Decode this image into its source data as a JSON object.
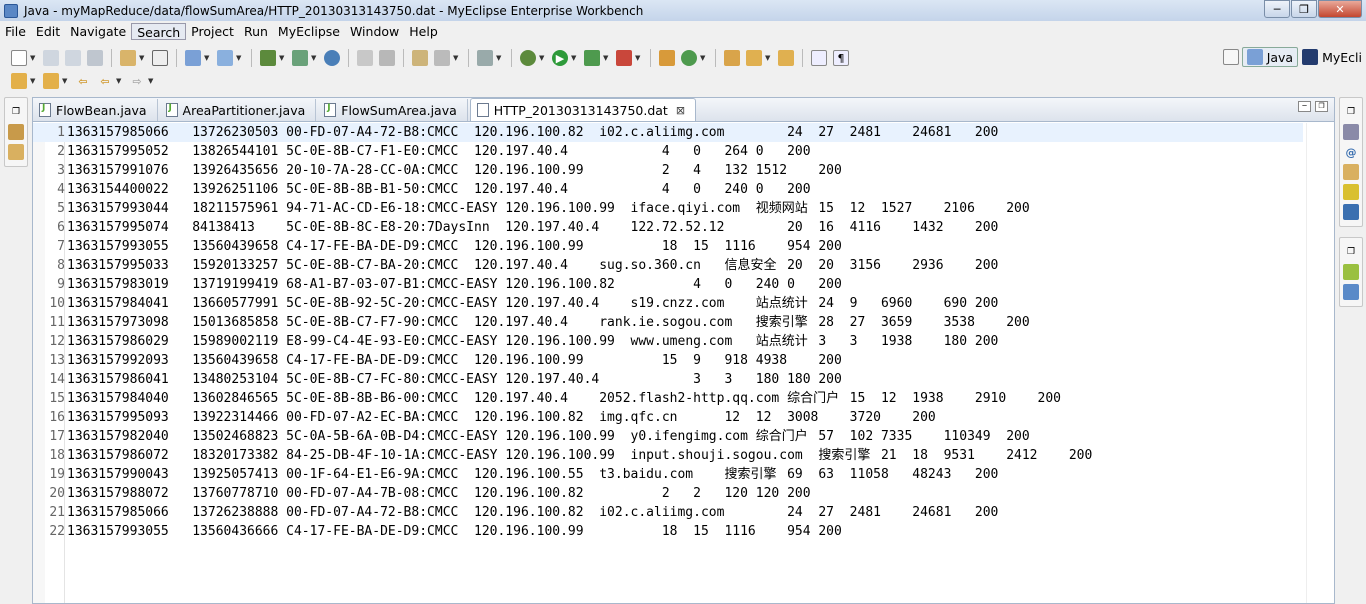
{
  "window": {
    "title": "Java - myMapReduce/data/flowSumArea/HTTP_20130313143750.dat - MyEclipse Enterprise Workbench",
    "minimize": "─",
    "maximize": "❐",
    "close": "✕"
  },
  "menu": [
    "File",
    "Edit",
    "Navigate",
    "Search",
    "Project",
    "Run",
    "MyEclipse",
    "Window",
    "Help"
  ],
  "perspectives": {
    "java": "Java",
    "myeclipse": "MyEcli"
  },
  "tabs": [
    {
      "label": "FlowBean.java",
      "type": "java"
    },
    {
      "label": "AreaPartitioner.java",
      "type": "java"
    },
    {
      "label": "FlowSumArea.java",
      "type": "java"
    },
    {
      "label": "HTTP_20130313143750.dat",
      "type": "text",
      "active": true
    }
  ],
  "tab_close": "⊠",
  "lines": [
    "1363157985066\t13726230503\t00-FD-07-A4-72-B8:CMCC\t120.196.100.82\ti02.c.aliimg.com\t\t24\t27\t2481\t24681\t200",
    "1363157995052\t13826544101\t5C-0E-8B-C7-F1-E0:CMCC\t120.197.40.4\t\t\t4\t0\t264\t0\t200",
    "1363157991076\t13926435656\t20-10-7A-28-CC-0A:CMCC\t120.196.100.99\t\t\t2\t4\t132\t1512\t200",
    "1363154400022\t13926251106\t5C-0E-8B-8B-B1-50:CMCC\t120.197.40.4\t\t\t4\t0\t240\t0\t200",
    "1363157993044\t18211575961\t94-71-AC-CD-E6-18:CMCC-EASY\t120.196.100.99\tiface.qiyi.com\t视频网站\t15\t12\t1527\t2106\t200",
    "1363157995074\t84138413\t5C-0E-8B-8C-E8-20:7DaysInn\t120.197.40.4\t122.72.52.12\t\t20\t16\t4116\t1432\t200",
    "1363157993055\t13560439658\tC4-17-FE-BA-DE-D9:CMCC\t120.196.100.99\t\t\t18\t15\t1116\t954\t200",
    "1363157995033\t15920133257\t5C-0E-8B-C7-BA-20:CMCC\t120.197.40.4\tsug.so.360.cn\t信息安全\t20\t20\t3156\t2936\t200",
    "1363157983019\t13719199419\t68-A1-B7-03-07-B1:CMCC-EASY\t120.196.100.82\t\t\t4\t0\t240\t0\t200",
    "1363157984041\t13660577991\t5C-0E-8B-92-5C-20:CMCC-EASY\t120.197.40.4\ts19.cnzz.com\t站点统计\t24\t9\t6960\t690\t200",
    "1363157973098\t15013685858\t5C-0E-8B-C7-F7-90:CMCC\t120.197.40.4\trank.ie.sogou.com\t搜索引擎\t28\t27\t3659\t3538\t200",
    "1363157986029\t15989002119\tE8-99-C4-4E-93-E0:CMCC-EASY\t120.196.100.99\twww.umeng.com\t站点统计\t3\t3\t1938\t180\t200",
    "1363157992093\t13560439658\tC4-17-FE-BA-DE-D9:CMCC\t120.196.100.99\t\t\t15\t9\t918\t4938\t200",
    "1363157986041\t13480253104\t5C-0E-8B-C7-FC-80:CMCC-EASY\t120.197.40.4\t\t\t3\t3\t180\t180\t200",
    "1363157984040\t13602846565\t5C-0E-8B-8B-B6-00:CMCC\t120.197.40.4\t2052.flash2-http.qq.com\t综合门户\t15\t12\t1938\t2910\t200",
    "1363157995093\t13922314466\t00-FD-07-A2-EC-BA:CMCC\t120.196.100.82\timg.qfc.cn\t\t12\t12\t3008\t3720\t200",
    "1363157982040\t13502468823\t5C-0A-5B-6A-0B-D4:CMCC-EASY\t120.196.100.99\ty0.ifengimg.com\t综合门户\t57\t102\t7335\t110349\t200",
    "1363157986072\t18320173382\t84-25-DB-4F-10-1A:CMCC-EASY\t120.196.100.99\tinput.shouji.sogou.com\t搜索引擎\t21\t18\t9531\t2412\t200",
    "1363157990043\t13925057413\t00-1F-64-E1-E6-9A:CMCC\t120.196.100.55\tt3.baidu.com\t搜索引擎\t69\t63\t11058\t48243\t200",
    "1363157988072\t13760778710\t00-FD-07-A4-7B-08:CMCC\t120.196.100.82\t\t\t2\t2\t120\t120\t200",
    "1363157985066\t13726238888\t00-FD-07-A4-72-B8:CMCC\t120.196.100.82\ti02.c.aliimg.com\t\t24\t27\t2481\t24681\t200",
    "1363157993055\t13560436666\tC4-17-FE-BA-DE-D9:CMCC\t120.196.100.99\t\t\t18\t15\t1116\t954\t200"
  ]
}
